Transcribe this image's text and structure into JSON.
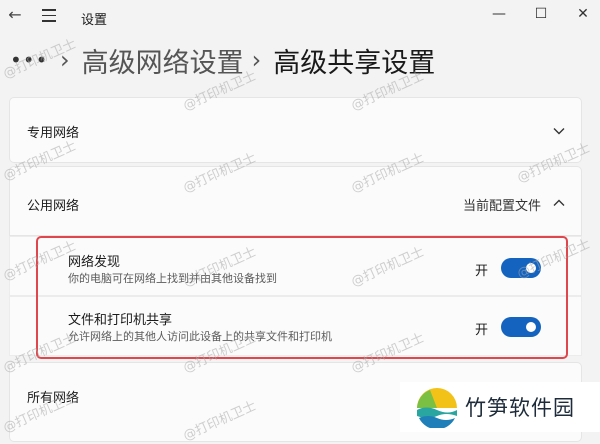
{
  "titlebar": {
    "title": "设置",
    "back_icon": "←",
    "minimize_icon": "—",
    "maximize_icon": "☐",
    "close_icon": "✕"
  },
  "breadcrumb": {
    "more": "•••",
    "parent": "高级网络设置",
    "current": "高级共享设置",
    "separator": "›"
  },
  "sections": {
    "private": {
      "label": "专用网络",
      "expanded": false
    },
    "public": {
      "label": "公用网络",
      "status": "当前配置文件",
      "expanded": true
    },
    "all": {
      "label": "所有网络"
    }
  },
  "options": [
    {
      "title": "网络发现",
      "description": "你的电脑可在网络上找到并由其他设备找到",
      "state_label": "开",
      "on": true
    },
    {
      "title": "文件和打印机共享",
      "description": "允许网络上的其他人访问此设备上的共享文件和打印机",
      "state_label": "开",
      "on": true
    }
  ],
  "watermark": "@打印机卫士",
  "brand": {
    "name": "竹笋软件园"
  },
  "colors": {
    "accent": "#1463bf",
    "highlight_border": "#e0474c"
  }
}
